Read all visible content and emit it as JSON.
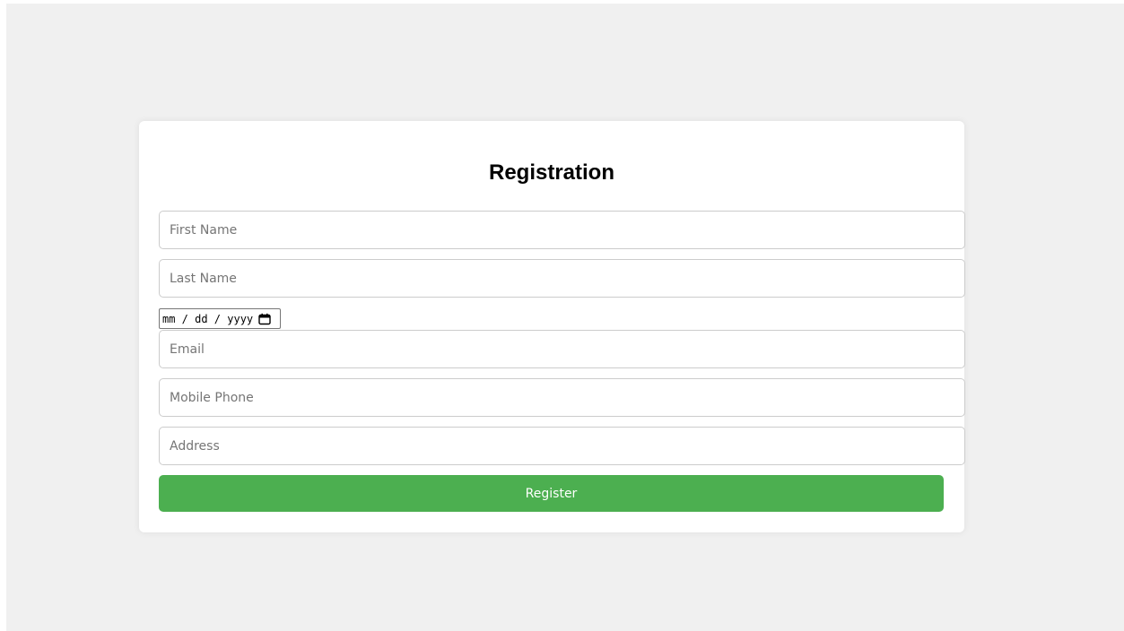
{
  "form": {
    "title": "Registration",
    "first_name": {
      "placeholder": "First Name",
      "value": ""
    },
    "last_name": {
      "placeholder": "Last Name",
      "value": ""
    },
    "birthdate": {
      "display": "mm / dd / yyyy",
      "icon": "calendar-icon"
    },
    "email": {
      "placeholder": "Email",
      "value": ""
    },
    "mobile_phone": {
      "placeholder": "Mobile Phone",
      "value": ""
    },
    "address": {
      "placeholder": "Address",
      "value": ""
    },
    "submit_label": "Register"
  },
  "colors": {
    "page_background": "#f0f0f0",
    "card_background": "#ffffff",
    "button": "#4caf50",
    "button_text": "#ffffff"
  }
}
